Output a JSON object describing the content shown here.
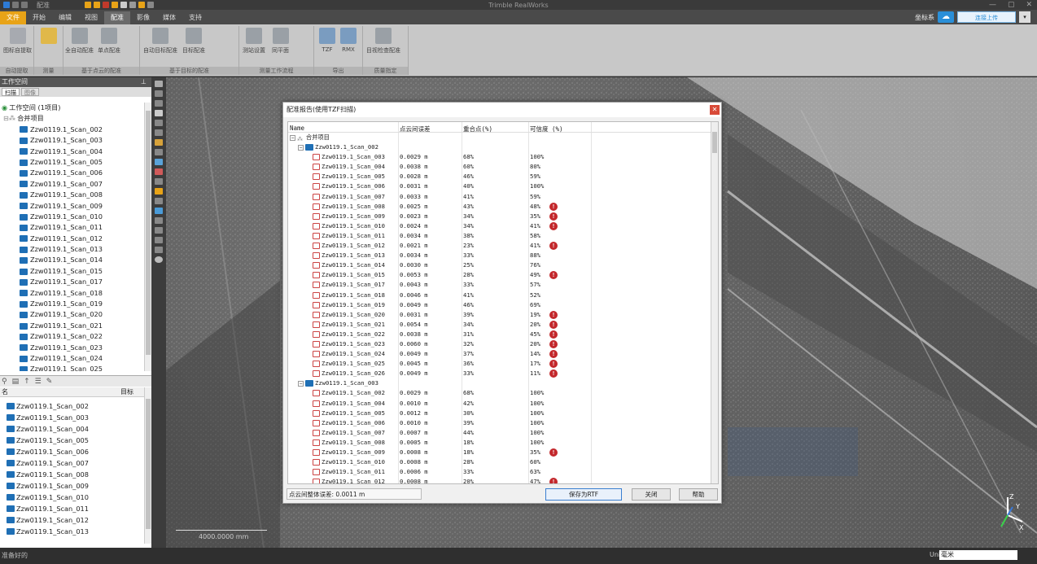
{
  "title_bar": {
    "app_title": "Trimble RealWorks",
    "doc_name": "配准",
    "controls": [
      "—",
      "▢",
      "✕"
    ]
  },
  "ribbon_tabs": [
    "文件",
    "开始",
    "编辑",
    "视图",
    "配准",
    "影像",
    "媒体",
    "支持"
  ],
  "account": {
    "label": "坐标系",
    "upload_label": "连接上传"
  },
  "ribbon_groups": [
    {
      "label": "自动提取",
      "buttons": [
        "图标自提取"
      ]
    },
    {
      "label": "测量",
      "buttons": [
        ""
      ]
    },
    {
      "label": "基于点云的配准",
      "buttons": [
        "全自动配准",
        "单点配准"
      ]
    },
    {
      "label": "基于目标的配准",
      "buttons": [
        "自动目标配准",
        "目标配准"
      ]
    },
    {
      "label": "测量工作流程",
      "buttons": [
        "测站设置",
        "同平面"
      ]
    },
    {
      "label": "导出",
      "buttons": [
        "TZF",
        "RMX"
      ]
    },
    {
      "label": "质量指定",
      "buttons": [
        "目视检查配准"
      ]
    }
  ],
  "workspace": {
    "panel_title": "工作空间",
    "tabs": [
      "扫描",
      "图像"
    ],
    "root": "工作空间 (1项目)",
    "project": "合并项目",
    "scans": [
      "Zzw0119.1_Scan_002",
      "Zzw0119.1_Scan_003",
      "Zzw0119.1_Scan_004",
      "Zzw0119.1_Scan_005",
      "Zzw0119.1_Scan_006",
      "Zzw0119.1_Scan_007",
      "Zzw0119.1_Scan_008",
      "Zzw0119.1_Scan_009",
      "Zzw0119.1_Scan_010",
      "Zzw0119.1_Scan_011",
      "Zzw0119.1_Scan_012",
      "Zzw0119.1_Scan_013",
      "Zzw0119.1_Scan_014",
      "Zzw0119.1_Scan_015",
      "Zzw0119.1_Scan_017",
      "Zzw0119.1_Scan_018",
      "Zzw0119.1_Scan_019",
      "Zzw0119.1_Scan_020",
      "Zzw0119.1_Scan_021",
      "Zzw0119.1_Scan_022",
      "Zzw0119.1_Scan_023",
      "Zzw0119.1_Scan_024",
      "Zzw0119.1_Scan_025"
    ]
  },
  "list_panel": {
    "col_name": "名",
    "col_target": "目标",
    "items": [
      "Zzw0119.1_Scan_002",
      "Zzw0119.1_Scan_003",
      "Zzw0119.1_Scan_004",
      "Zzw0119.1_Scan_005",
      "Zzw0119.1_Scan_006",
      "Zzw0119.1_Scan_007",
      "Zzw0119.1_Scan_008",
      "Zzw0119.1_Scan_009",
      "Zzw0119.1_Scan_010",
      "Zzw0119.1_Scan_011",
      "Zzw0119.1_Scan_012",
      "Zzw0119.1_Scan_013"
    ]
  },
  "viewport": {
    "scale_label": "4000.0000 mm"
  },
  "status_bar": {
    "status": "准备好的",
    "unit_label": "Uni",
    "unit_value": "毫米"
  },
  "dialog": {
    "title": "配准报告(使用TZF扫描)",
    "columns": [
      "Name",
      "点云间误差",
      "重合点(%)",
      "可信度 (%)"
    ],
    "root_label": "合并项目",
    "groups": [
      {
        "name": "Zzw0119.1_Scan_002",
        "rows": [
          {
            "name": "Zzw0119.1_Scan_003",
            "err": "0.0029 m",
            "overlap": "68%",
            "conf": "100%",
            "warn": false
          },
          {
            "name": "Zzw0119.1_Scan_004",
            "err": "0.0038 m",
            "overlap": "60%",
            "conf": "80%",
            "warn": false
          },
          {
            "name": "Zzw0119.1_Scan_005",
            "err": "0.0028 m",
            "overlap": "46%",
            "conf": "59%",
            "warn": false
          },
          {
            "name": "Zzw0119.1_Scan_006",
            "err": "0.0031 m",
            "overlap": "40%",
            "conf": "100%",
            "warn": false
          },
          {
            "name": "Zzw0119.1_Scan_007",
            "err": "0.0033 m",
            "overlap": "41%",
            "conf": "59%",
            "warn": false
          },
          {
            "name": "Zzw0119.1_Scan_008",
            "err": "0.0025 m",
            "overlap": "43%",
            "conf": "48%",
            "warn": true
          },
          {
            "name": "Zzw0119.1_Scan_009",
            "err": "0.0023 m",
            "overlap": "34%",
            "conf": "35%",
            "warn": true
          },
          {
            "name": "Zzw0119.1_Scan_010",
            "err": "0.0024 m",
            "overlap": "34%",
            "conf": "41%",
            "warn": true
          },
          {
            "name": "Zzw0119.1_Scan_011",
            "err": "0.0034 m",
            "overlap": "38%",
            "conf": "58%",
            "warn": false
          },
          {
            "name": "Zzw0119.1_Scan_012",
            "err": "0.0021 m",
            "overlap": "23%",
            "conf": "41%",
            "warn": true
          },
          {
            "name": "Zzw0119.1_Scan_013",
            "err": "0.0034 m",
            "overlap": "33%",
            "conf": "88%",
            "warn": false
          },
          {
            "name": "Zzw0119.1_Scan_014",
            "err": "0.0030 m",
            "overlap": "25%",
            "conf": "76%",
            "warn": false
          },
          {
            "name": "Zzw0119.1_Scan_015",
            "err": "0.0053 m",
            "overlap": "28%",
            "conf": "49%",
            "warn": true
          },
          {
            "name": "Zzw0119.1_Scan_017",
            "err": "0.0043 m",
            "overlap": "33%",
            "conf": "57%",
            "warn": false
          },
          {
            "name": "Zzw0119.1_Scan_018",
            "err": "0.0046 m",
            "overlap": "41%",
            "conf": "52%",
            "warn": false
          },
          {
            "name": "Zzw0119.1_Scan_019",
            "err": "0.0049 m",
            "overlap": "46%",
            "conf": "69%",
            "warn": false
          },
          {
            "name": "Zzw0119.1_Scan_020",
            "err": "0.0031 m",
            "overlap": "39%",
            "conf": "19%",
            "warn": true
          },
          {
            "name": "Zzw0119.1_Scan_021",
            "err": "0.0054 m",
            "overlap": "34%",
            "conf": "20%",
            "warn": true
          },
          {
            "name": "Zzw0119.1_Scan_022",
            "err": "0.0038 m",
            "overlap": "31%",
            "conf": "45%",
            "warn": true
          },
          {
            "name": "Zzw0119.1_Scan_023",
            "err": "0.0060 m",
            "overlap": "32%",
            "conf": "20%",
            "warn": true
          },
          {
            "name": "Zzw0119.1_Scan_024",
            "err": "0.0049 m",
            "overlap": "37%",
            "conf": "14%",
            "warn": true
          },
          {
            "name": "Zzw0119.1_Scan_025",
            "err": "0.0045 m",
            "overlap": "36%",
            "conf": "17%",
            "warn": true
          },
          {
            "name": "Zzw0119.1_Scan_026",
            "err": "0.0049 m",
            "overlap": "33%",
            "conf": "11%",
            "warn": true
          }
        ]
      },
      {
        "name": "Zzw0119.1_Scan_003",
        "rows": [
          {
            "name": "Zzw0119.1_Scan_002",
            "err": "0.0029 m",
            "overlap": "68%",
            "conf": "100%",
            "warn": false
          },
          {
            "name": "Zzw0119.1_Scan_004",
            "err": "0.0010 m",
            "overlap": "42%",
            "conf": "100%",
            "warn": false
          },
          {
            "name": "Zzw0119.1_Scan_005",
            "err": "0.0012 m",
            "overlap": "30%",
            "conf": "100%",
            "warn": false
          },
          {
            "name": "Zzw0119.1_Scan_006",
            "err": "0.0010 m",
            "overlap": "39%",
            "conf": "100%",
            "warn": false
          },
          {
            "name": "Zzw0119.1_Scan_007",
            "err": "0.0007 m",
            "overlap": "44%",
            "conf": "100%",
            "warn": false
          },
          {
            "name": "Zzw0119.1_Scan_008",
            "err": "0.0005 m",
            "overlap": "18%",
            "conf": "100%",
            "warn": false
          },
          {
            "name": "Zzw0119.1_Scan_009",
            "err": "0.0008 m",
            "overlap": "18%",
            "conf": "35%",
            "warn": true
          },
          {
            "name": "Zzw0119.1_Scan_010",
            "err": "0.0008 m",
            "overlap": "28%",
            "conf": "60%",
            "warn": false
          },
          {
            "name": "Zzw0119.1_Scan_011",
            "err": "0.0006 m",
            "overlap": "33%",
            "conf": "63%",
            "warn": false
          },
          {
            "name": "Zzw0119.1_Scan_012",
            "err": "0.0008 m",
            "overlap": "20%",
            "conf": "47%",
            "warn": true
          }
        ]
      }
    ],
    "rmse_label": "点云间整体误差: 0.0011 m",
    "buttons": {
      "save": "保存为RTF",
      "close": "关闭",
      "help": "帮助"
    }
  }
}
